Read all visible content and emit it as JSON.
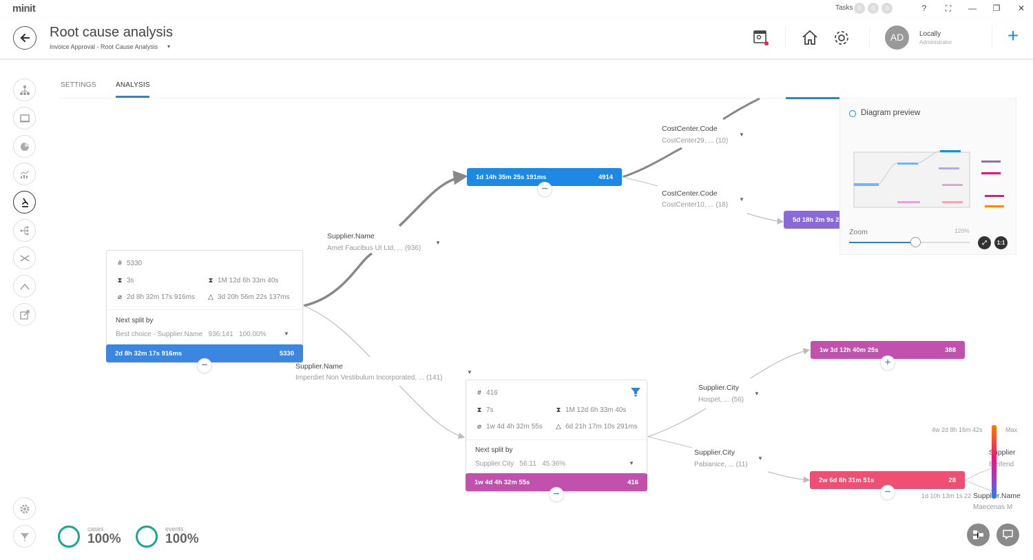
{
  "app": {
    "logo": "minit",
    "tasks_label": "Tasks",
    "tasks_counts": [
      "0",
      "0",
      "0"
    ],
    "window_buttons": {
      "help": "?",
      "fullscreen": "⛶",
      "minimize": "—",
      "restore": "❐",
      "close": "✕"
    }
  },
  "header": {
    "title": "Root cause analysis",
    "breadcrumb": "Invoice Approval - Root Cause Analysis",
    "breadcrumb_caret": "▾",
    "user": {
      "initials": "AD",
      "name": "Locally",
      "role": "Administrator"
    },
    "add_label": "+"
  },
  "tabs": [
    {
      "label": "SETTINGS",
      "active": false
    },
    {
      "label": "ANALYSIS",
      "active": true
    }
  ],
  "sidebar": {
    "items": [
      {
        "icon": "process-map-icon"
      },
      {
        "icon": "dashboard-icon"
      },
      {
        "icon": "pie-chart-icon"
      },
      {
        "icon": "performance-chart-icon"
      },
      {
        "icon": "microscope-icon",
        "active": true
      },
      {
        "icon": "flow-split-icon"
      },
      {
        "icon": "shuffle-icon"
      },
      {
        "icon": "rule-icon"
      },
      {
        "icon": "export-icon"
      }
    ],
    "bottom": [
      {
        "icon": "settings-gear-icon"
      },
      {
        "icon": "filter-icon"
      }
    ]
  },
  "colors": {
    "accent": "#1e88e5",
    "bar_blue": "#3a86e0",
    "bar_magenta": "#c251ae",
    "bar_pink": "#ef4f72",
    "bar_purple": "#8a6ad6",
    "kpi_ring": "#16a88c"
  },
  "root_node": {
    "count": "5330",
    "min": "3s",
    "max": "1M 12d 6h 33m 40s",
    "avg": "2d 8h 32m 17s 916ms",
    "median": "3d 20h 56m 22s 137ms",
    "next_split_label": "Next split by",
    "next_split_value": "Best choice - Supplier.Name",
    "next_split_ratio": "936:141",
    "next_split_pct": "100.00%",
    "bar_label": "2d 8h 32m 17s 916ms",
    "bar_count": "5330",
    "toggle": "−"
  },
  "edges": [
    {
      "title": "Supplier.Name",
      "value": "Amet Faucibus Ut Ltd, ... (936)"
    },
    {
      "title": "Supplier.Name",
      "value": "Imperdiet Non Vestibulum Incorporated, ... (141)"
    },
    {
      "title": "CostCenter.Code",
      "value": "CostCenter29, ... (10)"
    },
    {
      "title": "CostCenter.Code",
      "value": "CostCenter10, ... (18)"
    },
    {
      "title": "Supplier.City",
      "value": "Hospet, ... (56)"
    },
    {
      "title": "Supplier.City",
      "value": "Pabianice, ... (11)"
    },
    {
      "title": "Supplier",
      "value": "Eleifend"
    },
    {
      "title": "Supplier.Name",
      "value": "Maecenas M"
    }
  ],
  "nodes": [
    {
      "label": "1d 14h 35m 25s 191ms",
      "count": "4914",
      "toggle": "−"
    },
    {
      "label": "5d 18h 2m 9s 2",
      "count": ""
    },
    {
      "label": "1w 3d 12h 40m 25s",
      "count": "388",
      "toggle": "+"
    },
    {
      "label": "2w 6d 8h 31m 51s",
      "count": "28",
      "toggle": "−"
    }
  ],
  "selected_node": {
    "count": "416",
    "min": "7s",
    "max": "1M 12d 6h 33m 40s",
    "avg": "1w 4d 4h 32m 55s",
    "median": "6d 21h 17m 10s 291ms",
    "next_split_label": "Next split by",
    "next_split_value": "Supplier.City",
    "next_split_ratio": "56:11",
    "next_split_pct": "45.36%",
    "bar_label": "1w 4d 4h 32m 55s",
    "bar_count": "416",
    "toggle": "−"
  },
  "preview": {
    "title": "Diagram preview",
    "zoom_label": "Zoom",
    "zoom_value": "120%",
    "zoom_fraction": 0.55,
    "fit_button": "⤢",
    "actual_size_button": "1:1"
  },
  "legend": {
    "max_label": "Max",
    "max_value": "4w 2d 8h 16m 42s",
    "min_value": "1d 10h 13m 1s 22"
  },
  "kpis": [
    {
      "label": "cases",
      "value": "100%"
    },
    {
      "label": "events",
      "value": "100%"
    }
  ]
}
